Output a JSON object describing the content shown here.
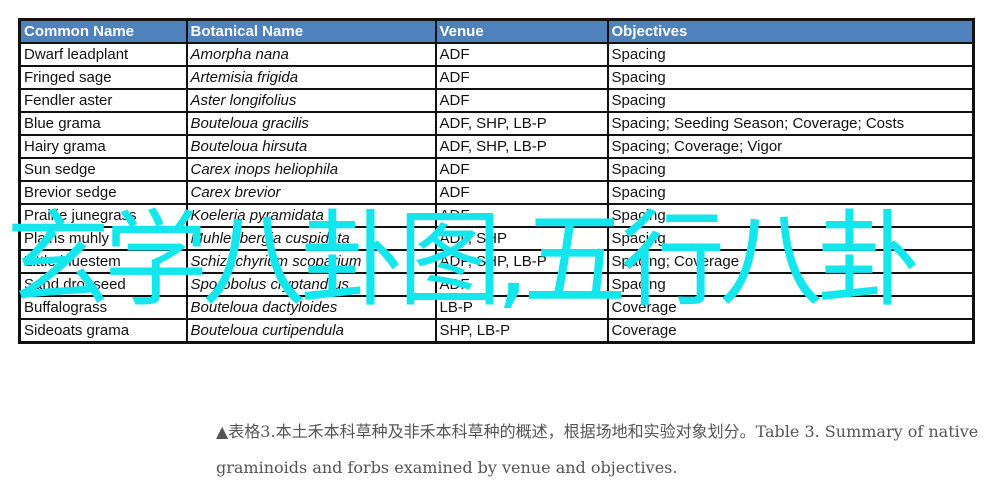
{
  "table": {
    "header_color": "#4f81bd",
    "columns": [
      "Common Name",
      "Botanical  Name",
      "Venue",
      "Objectives"
    ],
    "rows": [
      {
        "common": "Dwarf leadplant",
        "botanical": "Amorpha nana",
        "venue": "ADF",
        "objectives": "Spacing"
      },
      {
        "common": "Fringed sage",
        "botanical": "Artemisia frigida",
        "venue": "ADF",
        "objectives": "Spacing"
      },
      {
        "common": "Fendler aster",
        "botanical": "Aster longifolius",
        "venue": "ADF",
        "objectives": "Spacing"
      },
      {
        "common": "Blue grama",
        "botanical": "Bouteloua gracilis",
        "venue": "ADF, SHP, LB-P",
        "objectives": "Spacing; Seeding Season;  Coverage; Costs"
      },
      {
        "common": "Hairy grama",
        "botanical": "Bouteloua hirsuta",
        "venue": "ADF, SHP, LB-P",
        "objectives": "Spacing; Coverage; Vigor"
      },
      {
        "common": "Sun sedge",
        "botanical": "Carex inops heliophila",
        "venue": "ADF",
        "objectives": "Spacing"
      },
      {
        "common": "Brevior sedge",
        "botanical": "Carex brevior",
        "venue": "ADF",
        "objectives": "Spacing"
      },
      {
        "common": "Prairie junegrass",
        "botanical": "Koeleria pyramidata",
        "venue": "ADF",
        "objectives": "Spacing"
      },
      {
        "common": "Plains muhly",
        "botanical": "Muhlenbergia cuspidata",
        "venue": "ADF, SHP",
        "objectives": "Spacing"
      },
      {
        "common": "Little bluestem",
        "botanical": "Schizachyrium scoparium",
        "venue": "ADF, SHP, LB-P",
        "objectives": "Spacing; Coverage"
      },
      {
        "common": "Sand dropseed",
        "botanical": "Sporobolus cryptandrus",
        "venue": "ADF",
        "objectives": "Spacing"
      },
      {
        "common": "Buffalograss",
        "botanical": "Bouteloua dactyloides",
        "venue": "LB-P",
        "objectives": "Coverage"
      },
      {
        "common": "Sideoats grama",
        "botanical": "Bouteloua curtipendula",
        "venue": "SHP, LB-P",
        "objectives": "Coverage"
      }
    ]
  },
  "watermark": {
    "text": "玄学八卦图,五行八卦",
    "color": "#14e6ee"
  },
  "caption": {
    "text": "▲表格3.本土禾本科草种及非禾本科草种的概述，根据场地和实验对象划分。Table 3. Summary of native graminoids and forbs examined by venue and objectives."
  }
}
